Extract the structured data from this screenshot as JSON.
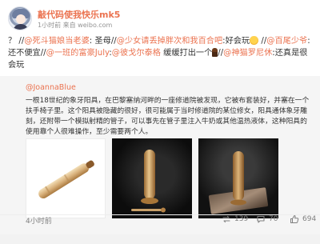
{
  "post": {
    "username": "敲代码使我快乐mk5",
    "time_ago": "1小时前",
    "source": "来自 weibo.com",
    "text": {
      "p1": "？ //",
      "m1": "@死斗猫娘当老婆",
      "p2": ": 圣母//",
      "m2": "@少女请丢掉胖次和我百合吧",
      "p3": ":好会玩",
      "p4": " //",
      "m3": "@百尾少爷",
      "p5": ":还不便宜//",
      "m4": "@一班的富豪July",
      "p6": ":",
      "m5": "@彼戈尔泰格",
      "p7": " 缓缓打出一个",
      "p8": "//",
      "m6": "@神猫罗尼休",
      "p9": ":还真是很会玩"
    },
    "emojis": {
      "e1": "smile-emoji",
      "e2": "torch-emoji"
    }
  },
  "retweet": {
    "user": "@JoannaBlue",
    "text": "一根18世纪的象牙阳具，在巴黎塞纳河畔的一座修道院被发现，它被布套装好，并塞在一个扶手椅子里。这个阳具被隐藏的很好，很可能属于当时修道院的某位修女，阳具通体象牙雕刻，还附带一个模拟射精的管子，可以事先在管子里注入牛奶或其他温热液体，这种阳具的使用靠个人很难操作，至少需要两个人。",
    "images": [
      "ivory-object-photo-1",
      "ivory-object-photo-2",
      "ivory-object-photo-3"
    ],
    "time_ago": "4小时前",
    "reposts": "139",
    "comments": "70",
    "likes": "694"
  },
  "colors": {
    "link": "#eb7350",
    "text": "#333333",
    "muted": "#939393",
    "retweet_bg": "#f5f5f5"
  }
}
